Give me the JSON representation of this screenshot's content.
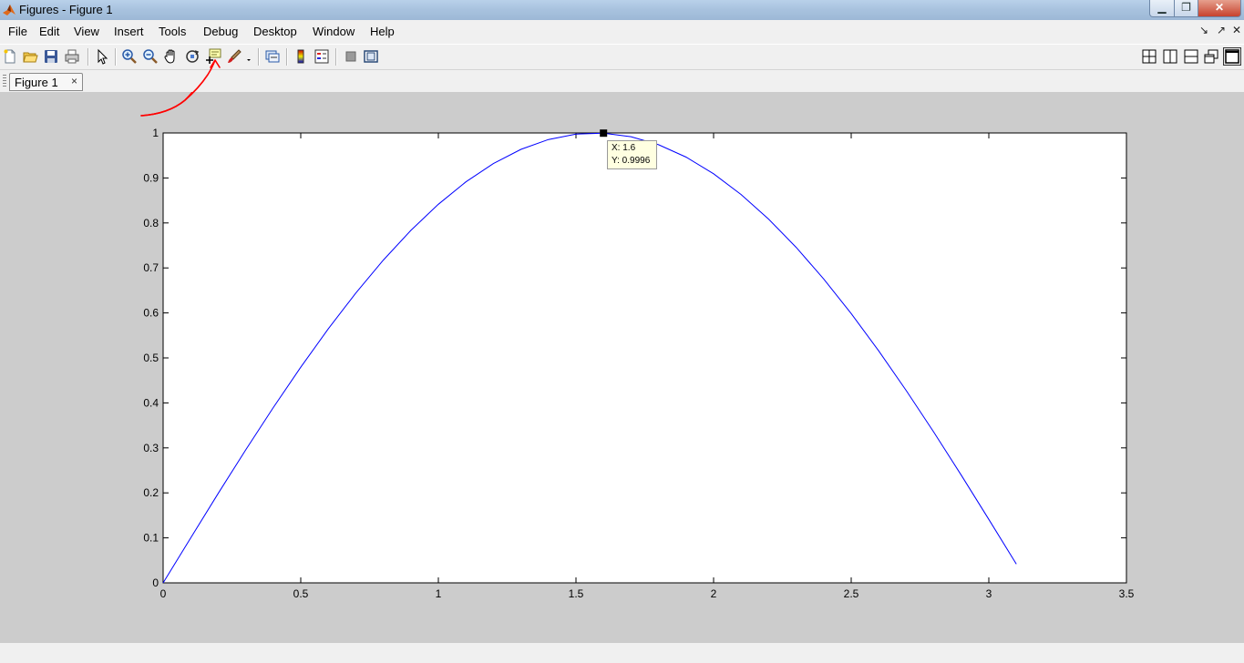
{
  "window": {
    "title": "Figures - Figure 1",
    "min_glyph": "▁",
    "max_glyph": "❐",
    "close_glyph": "✕"
  },
  "menu": [
    "File",
    "Edit",
    "View",
    "Insert",
    "Tools",
    "Debug",
    "Desktop",
    "Window",
    "Help"
  ],
  "dock_controls": [
    "↘",
    "↗",
    "✕"
  ],
  "toolbar": {
    "icons": [
      "new-figure-icon",
      "open-file-icon",
      "save-icon",
      "print-icon",
      "edit-plot-arrow-icon",
      "zoom-in-icon",
      "zoom-out-icon",
      "pan-hand-icon",
      "rotate-3d-icon",
      "data-cursor-icon",
      "brush-icon",
      "link-plot-icon",
      "colorbar-icon",
      "legend-icon",
      "hide-plot-tools-icon",
      "show-plot-tools-icon"
    ],
    "layout_icons": [
      "tile-grid-icon",
      "split-vertical-icon",
      "split-horizontal-icon",
      "float-icon",
      "maximize-icon"
    ]
  },
  "tab": {
    "label": "Figure 1",
    "close": "×"
  },
  "datatip": {
    "x_text": "X: 1.6",
    "y_text": "Y: 0.9996"
  },
  "accent": {
    "line": "#0000ff",
    "annotation": "#ff0000"
  },
  "chart_data": {
    "type": "line",
    "title": "",
    "xlabel": "",
    "ylabel": "",
    "xlim": [
      0,
      3.5
    ],
    "ylim": [
      0,
      1
    ],
    "xticks": [
      "0",
      "0.5",
      "1",
      "1.5",
      "2",
      "2.5",
      "3",
      "3.5"
    ],
    "yticks": [
      "0",
      "0.1",
      "0.2",
      "0.3",
      "0.4",
      "0.5",
      "0.6",
      "0.7",
      "0.8",
      "0.9",
      "1"
    ],
    "grid": false,
    "series": [
      {
        "x": [
          0,
          0.1,
          0.2,
          0.3,
          0.4,
          0.5,
          0.6,
          0.7,
          0.8,
          0.9,
          1.0,
          1.1,
          1.2,
          1.3,
          1.4,
          1.5,
          1.6,
          1.7,
          1.8,
          1.9,
          2.0,
          2.1,
          2.2,
          2.3,
          2.4,
          2.5,
          2.6,
          2.7,
          2.8,
          2.9,
          3.0,
          3.1
        ],
        "y": [
          0,
          0.0998,
          0.1987,
          0.2955,
          0.3894,
          0.4794,
          0.5646,
          0.6442,
          0.7174,
          0.7833,
          0.8415,
          0.8912,
          0.932,
          0.9636,
          0.9854,
          0.9975,
          0.9996,
          0.9917,
          0.9738,
          0.9463,
          0.9093,
          0.8632,
          0.8085,
          0.7457,
          0.6755,
          0.5985,
          0.5155,
          0.4274,
          0.335,
          0.2392,
          0.1411,
          0.0416
        ]
      }
    ],
    "datatip_point": {
      "x": 1.6,
      "y": 0.9996
    }
  }
}
